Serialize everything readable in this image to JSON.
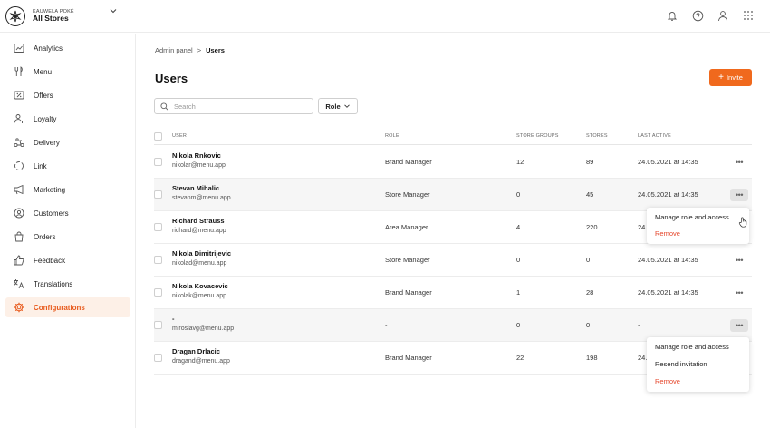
{
  "brand": {
    "name": "KAUWELA POKÉ",
    "store": "All Stores"
  },
  "sidebar": {
    "items": [
      {
        "label": "Analytics",
        "icon": "analytics-icon"
      },
      {
        "label": "Menu",
        "icon": "fork-knife-icon"
      },
      {
        "label": "Offers",
        "icon": "offers-icon"
      },
      {
        "label": "Loyalty",
        "icon": "loyalty-icon"
      },
      {
        "label": "Delivery",
        "icon": "scooter-icon"
      },
      {
        "label": "Link",
        "icon": "link-icon"
      },
      {
        "label": "Marketing",
        "icon": "megaphone-icon"
      },
      {
        "label": "Customers",
        "icon": "customers-icon"
      },
      {
        "label": "Orders",
        "icon": "orders-icon"
      },
      {
        "label": "Feedback",
        "icon": "thumbs-up-icon"
      },
      {
        "label": "Translations",
        "icon": "translate-icon"
      },
      {
        "label": "Configurations",
        "icon": "gear-icon",
        "active": true
      }
    ]
  },
  "breadcrumb": {
    "root": "Admin panel",
    "separator": ">",
    "current": "Users"
  },
  "page": {
    "title": "Users",
    "invite_label": "Invite"
  },
  "search": {
    "placeholder": "Search"
  },
  "filter": {
    "role_label": "Role"
  },
  "table": {
    "headers": {
      "user": "USER",
      "role": "ROLE",
      "store_groups": "STORE GROUPS",
      "stores": "STORES",
      "last_active": "LAST ACTIVE"
    },
    "rows": [
      {
        "name": "Nikola Rnkovic",
        "email": "nikolar@menu.app",
        "role": "Brand Manager",
        "store_groups": "12",
        "stores": "89",
        "last_active": "24.05.2021 at 14:35",
        "more": "•••"
      },
      {
        "name": "Stevan Mihalic",
        "email": "stevanm@menu.app",
        "role": "Store Manager",
        "store_groups": "0",
        "stores": "45",
        "last_active": "24.05.2021 at 14:35",
        "more": "•••"
      },
      {
        "name": "Richard Strauss",
        "email": "richard@menu.app",
        "role": "Area Manager",
        "store_groups": "4",
        "stores": "220",
        "last_active": "24.",
        "more": ""
      },
      {
        "name": "Nikola Dimitrijevic",
        "email": "nikolad@menu.app",
        "role": "Store Manager",
        "store_groups": "0",
        "stores": "0",
        "last_active": "24.05.2021 at 14:35",
        "more": "•••"
      },
      {
        "name": "Nikola Kovacevic",
        "email": "nikolak@menu.app",
        "role": "Brand Manager",
        "store_groups": "1",
        "stores": "28",
        "last_active": "24.05.2021 at 14:35",
        "more": "•••"
      },
      {
        "name": "-",
        "email": "miroslavg@menu.app",
        "role": "-",
        "store_groups": "0",
        "stores": "0",
        "last_active": "-",
        "more": "•••"
      },
      {
        "name": "Dragan Drlacic",
        "email": "dragand@menu.app",
        "role": "Brand Manager",
        "store_groups": "22",
        "stores": "198",
        "last_active": "24.",
        "more": ""
      }
    ]
  },
  "menus": {
    "first": {
      "manage": "Manage role and access",
      "remove": "Remove"
    },
    "second": {
      "manage": "Manage role and access",
      "resend": "Resend invitation",
      "remove": "Remove"
    }
  },
  "colors": {
    "accent": "#f0691d",
    "danger": "#e5452a",
    "active_bg": "#fdf0e7"
  }
}
